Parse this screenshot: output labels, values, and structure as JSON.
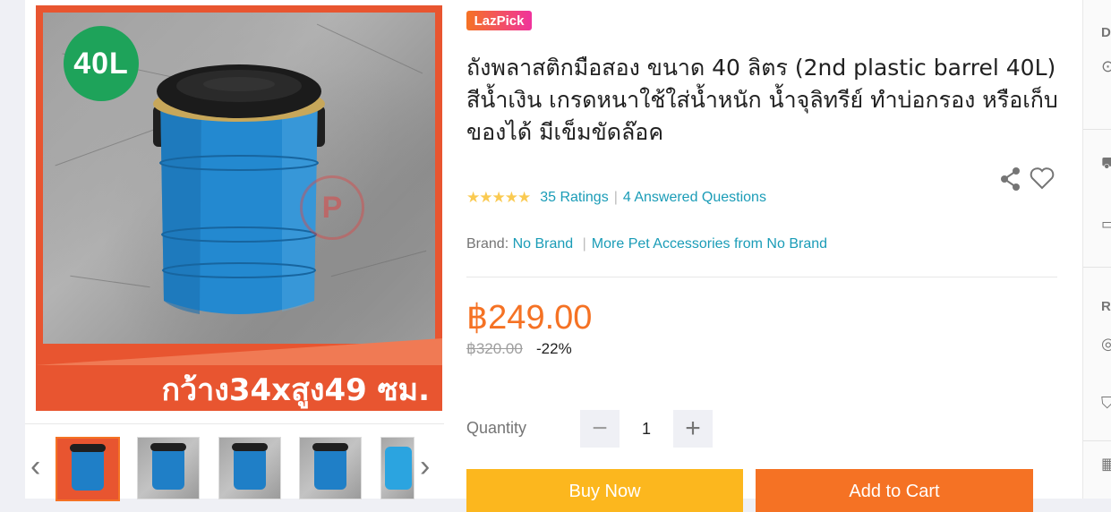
{
  "gallery": {
    "badge_text": "40L",
    "watermark_text": "P",
    "size_caption": "กว้าง34xสูง49 ซม.",
    "prev_arrow": "‹",
    "next_arrow": "›",
    "thumbnails": [
      "thumb-1",
      "thumb-2",
      "thumb-3",
      "thumb-4",
      "thumb-5"
    ],
    "active_thumb_label": "40L"
  },
  "product": {
    "tag": "LazPick",
    "title": "ถังพลาสติกมือสอง ขนาด 40 ลิตร (2nd plastic barrel 40L) สีน้ำเงิน เกรดหนาใช้ใส่น้ำหนัก น้ำจุลิทรีย์ ทำบ่อกรอง หรือเก็บของได้ มีเข็มขัดล๊อค",
    "stars": "★★★★★",
    "ratings": "35 Ratings",
    "questions": "4 Answered Questions",
    "brand_label": "Brand:",
    "brand": "No Brand",
    "more_from": "More Pet Accessories from No Brand",
    "price": "฿249.00",
    "old_price": "฿320.00",
    "discount": "-22%",
    "quantity_label": "Quantity",
    "quantity": "1",
    "minus": "−",
    "plus": "+",
    "buy_now": "Buy Now",
    "add_to_cart": "Add to Cart"
  },
  "right_column": {
    "top_letter": "D",
    "mid_letter": "R"
  },
  "colors": {
    "accent": "#f57224",
    "link": "#1a9cb7",
    "star": "#faca51",
    "badge_green": "#1ea35a",
    "banner_orange": "#e85530",
    "buy_now": "#fcb71e"
  },
  "icons": [
    "share-icon",
    "heart-icon",
    "chevron-left-icon",
    "chevron-right-icon",
    "minus-icon",
    "plus-icon"
  ]
}
